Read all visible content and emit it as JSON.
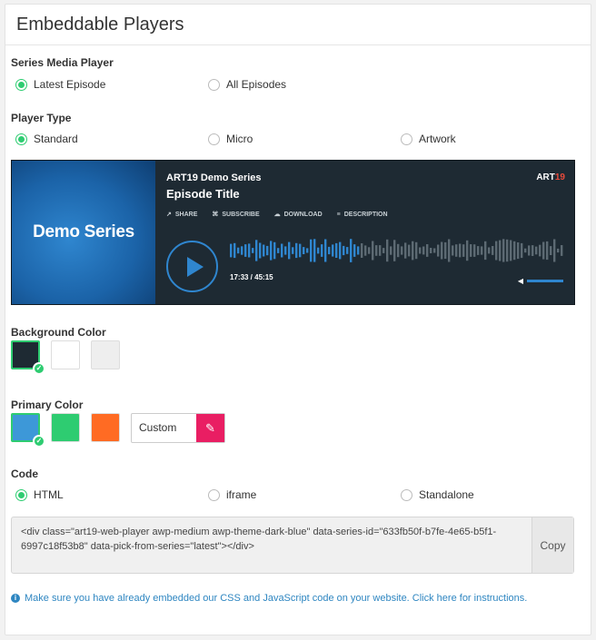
{
  "header": {
    "title": "Embeddable Players"
  },
  "series_media_player": {
    "label": "Series Media Player",
    "options": [
      {
        "label": "Latest Episode",
        "checked": true
      },
      {
        "label": "All Episodes",
        "checked": false
      }
    ]
  },
  "player_type": {
    "label": "Player Type",
    "options": [
      {
        "label": "Standard",
        "checked": true
      },
      {
        "label": "Micro",
        "checked": false
      },
      {
        "label": "Artwork",
        "checked": false
      }
    ]
  },
  "player": {
    "artwork_text": "Demo Series",
    "series": "ART19 Demo Series",
    "episode_title": "Episode Title",
    "logo_main": "ART",
    "logo_accent": "19",
    "actions": [
      "SHARE",
      "SUBSCRIBE",
      "DOWNLOAD",
      "DESCRIPTION"
    ],
    "time": "17:33 / 45:15",
    "played_fraction": 0.39,
    "bg_color": "#1e2a33",
    "accent_color": "#2f86cf"
  },
  "background_color": {
    "label": "Background Color",
    "swatches": [
      {
        "color": "#1e2a33",
        "selected": true
      },
      {
        "color": "#ffffff",
        "selected": false
      },
      {
        "color": "#eeeeee",
        "selected": false
      }
    ]
  },
  "primary_color": {
    "label": "Primary Color",
    "swatches": [
      {
        "color": "#3d98d8",
        "selected": true
      },
      {
        "color": "#2ecc71",
        "selected": false
      },
      {
        "color": "#ff6b23",
        "selected": false
      }
    ],
    "custom_label": "Custom",
    "picker_color": "#e91e63"
  },
  "code": {
    "label": "Code",
    "options": [
      {
        "label": "HTML",
        "checked": true
      },
      {
        "label": "iframe",
        "checked": false
      },
      {
        "label": "Standalone",
        "checked": false
      }
    ],
    "snippet": "<div class=\"art19-web-player awp-medium awp-theme-dark-blue\" data-series-id=\"633fb50f-b7fe-4e65-b5f1-6997c18f53b8\" data-pick-from-series=\"latest\"></div>",
    "copy_label": "Copy"
  },
  "note": "Make sure you have already embedded our CSS and JavaScript code on your website. Click here for instructions."
}
